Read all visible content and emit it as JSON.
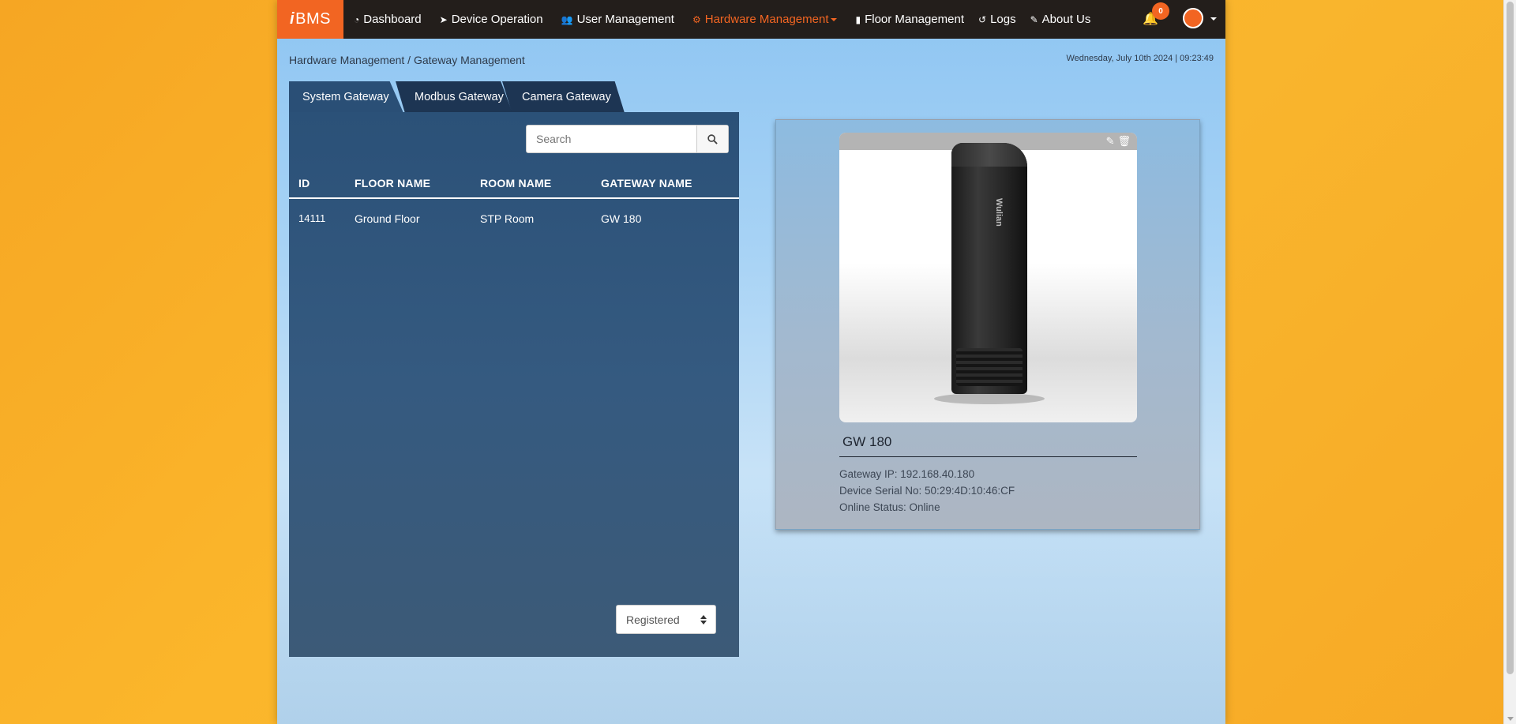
{
  "navbar": {
    "brand_i": "i",
    "brand_text": "BMS",
    "items": [
      {
        "label": "Dashboard",
        "icon": "tachometer-icon"
      },
      {
        "label": "Device Operation",
        "icon": "location-arrow-icon"
      },
      {
        "label": "User Management",
        "icon": "users-icon"
      },
      {
        "label": "Hardware Management",
        "icon": "cogs-icon",
        "active": true
      },
      {
        "label": "Floor Management",
        "icon": "building-icon"
      },
      {
        "label": "Logs",
        "icon": "history-icon"
      },
      {
        "label": "About Us",
        "icon": "edit-icon"
      }
    ],
    "notification_count": "0",
    "accent_color": "#f26522"
  },
  "breadcrumb": "Hardware Management / Gateway Management",
  "datetime": "Wednesday, July 10th 2024  |  09:23:49",
  "tabs": [
    "System Gateway",
    "Modbus Gateway",
    "Camera Gateway"
  ],
  "search": {
    "placeholder": "Search",
    "value": ""
  },
  "table": {
    "headers": [
      "ID",
      "FLOOR NAME",
      "ROOM NAME",
      "GATEWAY NAME"
    ],
    "rows": [
      {
        "id": "14111",
        "floor": "Ground Floor",
        "room": "STP Room",
        "gateway": "GW 180"
      }
    ]
  },
  "filter_select": {
    "selected": "Registered"
  },
  "detail": {
    "name": "GW 180",
    "device_logo": "Wulian",
    "ip_line": "Gateway IP: 192.168.40.180",
    "serial_line": "Device Serial No: 50:29:4D:10:46:CF",
    "status_line": "Online Status: Online"
  }
}
